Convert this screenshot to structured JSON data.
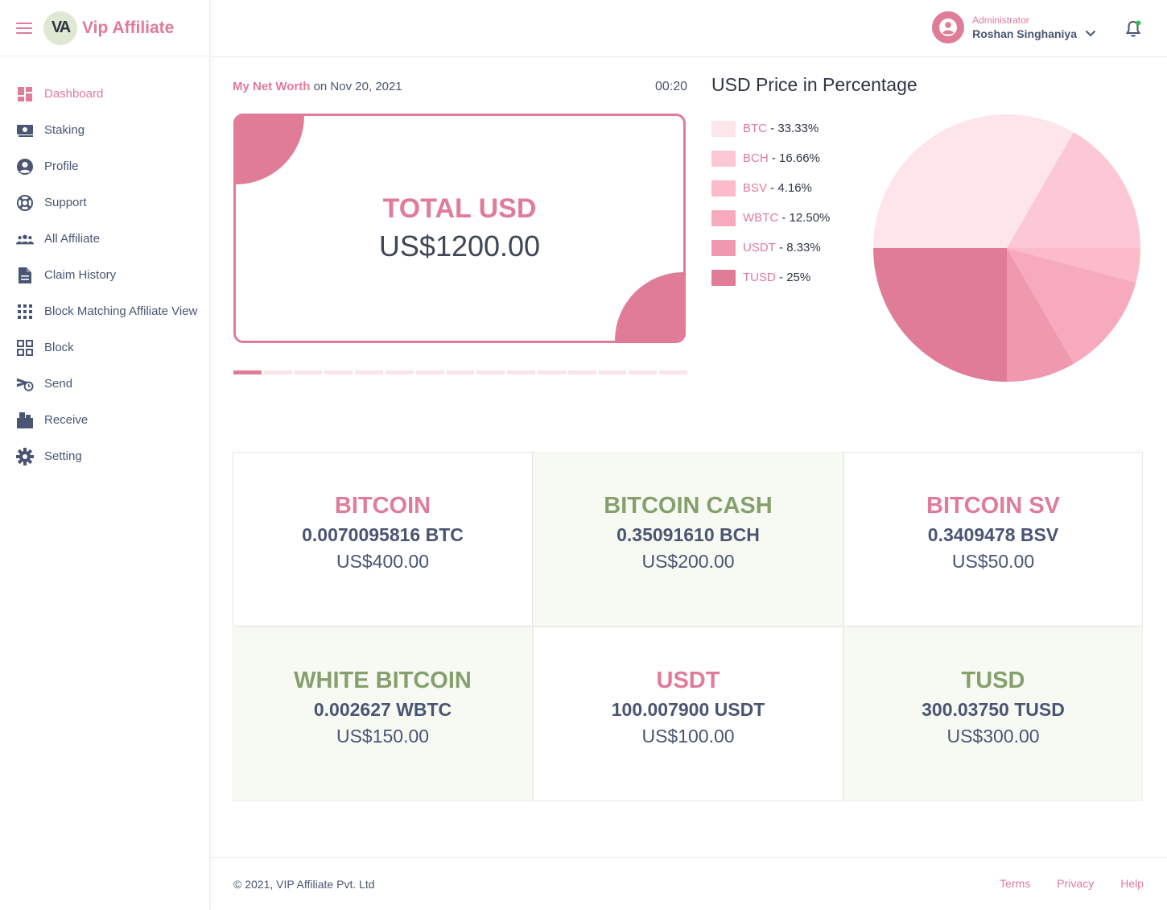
{
  "brand": {
    "logo_text": "VA",
    "name": "Vip Affiliate"
  },
  "sidebar": {
    "items": [
      {
        "label": "Dashboard",
        "icon": "dashboard-icon",
        "active": true
      },
      {
        "label": "Staking",
        "icon": "money-icon"
      },
      {
        "label": "Profile",
        "icon": "account-circle-icon"
      },
      {
        "label": "Support",
        "icon": "lifebuoy-icon"
      },
      {
        "label": "All Affiliate",
        "icon": "group-icon"
      },
      {
        "label": "Claim History",
        "icon": "document-icon"
      },
      {
        "label": "Block Matching Affiliate View",
        "icon": "grid-dots-icon"
      },
      {
        "label": "Block",
        "icon": "grid-squares-icon"
      },
      {
        "label": "Send",
        "icon": "send-clock-icon"
      },
      {
        "label": "Receive",
        "icon": "receive-box-icon"
      },
      {
        "label": "Setting",
        "icon": "gear-icon"
      }
    ]
  },
  "header": {
    "role": "Administrator",
    "user_name": "Roshan Singhaniya",
    "notification_dot_color": "#2fbf4e"
  },
  "net_worth": {
    "title": "My Net Worth",
    "date_text": "on Nov 20, 2021",
    "timer": "00:20",
    "total_label": "TOTAL USD",
    "total_value": "US$1200.00",
    "carousel_slides": 15,
    "carousel_active": 1
  },
  "chart_data": {
    "type": "pie",
    "title": "USD Price in Percentage",
    "slices": [
      {
        "label": "BTC",
        "percent_text": "33.33%",
        "value": 33.33,
        "color": "#fde5eb"
      },
      {
        "label": "BCH",
        "percent_text": "16.66%",
        "value": 16.66,
        "color": "#fcc8d5"
      },
      {
        "label": "BSV",
        "percent_text": "4.16%",
        "value": 4.16,
        "color": "#fbbbcb"
      },
      {
        "label": "WBTC",
        "percent_text": "12.50%",
        "value": 12.5,
        "color": "#f7aabd"
      },
      {
        "label": "USDT",
        "percent_text": "8.33%",
        "value": 8.33,
        "color": "#ef98ae"
      },
      {
        "label": "TUSD",
        "percent_text": "25%",
        "value": 25,
        "color": "#e07b98"
      }
    ]
  },
  "coins": [
    {
      "name": "BITCOIN",
      "amount": "0.0070095816 BTC",
      "usd": "US$400.00",
      "name_color": "pink",
      "bg": "white"
    },
    {
      "name": "BITCOIN CASH",
      "amount": "0.35091610 BCH",
      "usd": "US$200.00",
      "name_color": "olive",
      "bg": "green"
    },
    {
      "name": "BITCOIN SV",
      "amount": "0.3409478 BSV",
      "usd": "US$50.00",
      "name_color": "pink",
      "bg": "white"
    },
    {
      "name": "WHITE BITCOIN",
      "amount": "0.002627 WBTC",
      "usd": "US$150.00",
      "name_color": "olive",
      "bg": "green"
    },
    {
      "name": "USDT",
      "amount": "100.007900 USDT",
      "usd": "US$100.00",
      "name_color": "pink",
      "bg": "white"
    },
    {
      "name": "TUSD",
      "amount": "300.03750 TUSD",
      "usd": "US$300.00",
      "name_color": "olive",
      "bg": "green"
    }
  ],
  "footer": {
    "copyright": "© 2021, VIP Affiliate Pvt. Ltd",
    "links": [
      "Terms",
      "Privacy",
      "Help"
    ]
  },
  "colors": {
    "accent": "#e07b98",
    "olive": "#86a06d",
    "text": "#4a5573"
  }
}
